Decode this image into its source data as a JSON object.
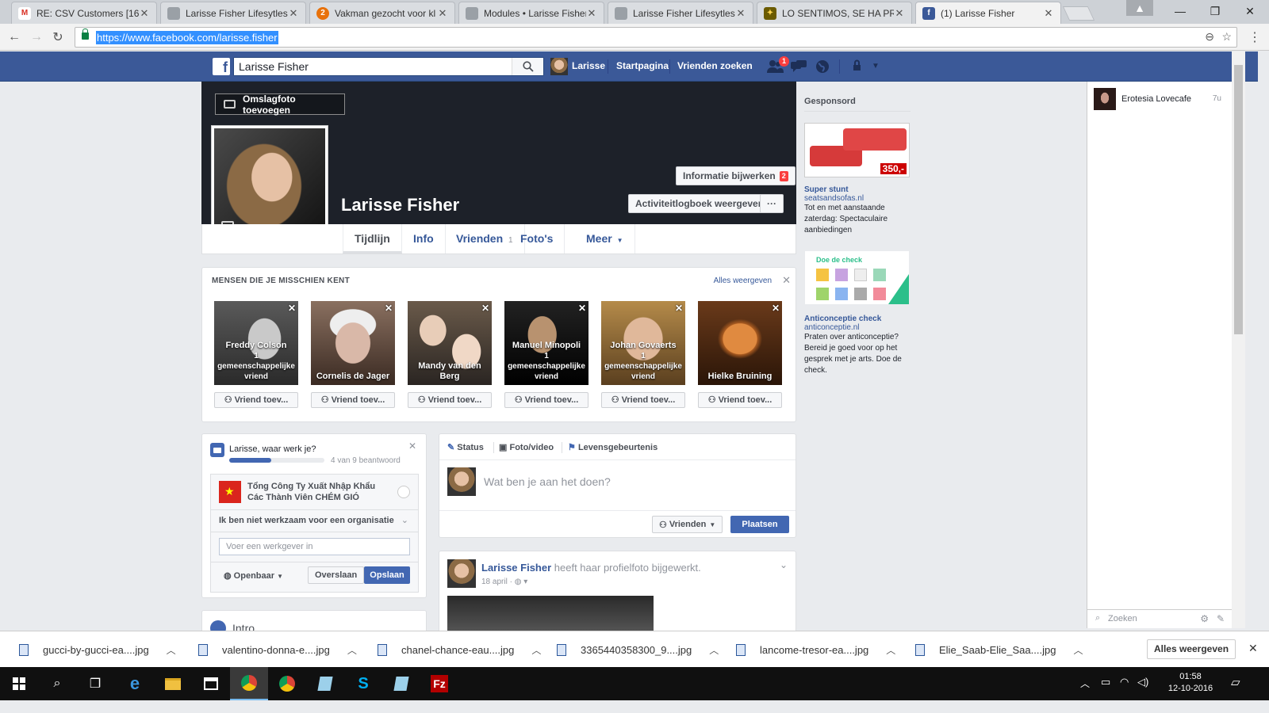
{
  "browser": {
    "tabs": [
      {
        "label": "RE: CSV Customers [1610",
        "icon": "gmail-icon",
        "color": "#d93025",
        "glyph": "M"
      },
      {
        "label": "Larisse Fisher Lifesytlesh",
        "icon": "joomla-icon",
        "color": "#9aa0a6",
        "glyph": ""
      },
      {
        "label": "Vakman gezocht voor kl",
        "icon": "werkspot-icon",
        "color": "#e8710a",
        "glyph": "2"
      },
      {
        "label": "Modules • Larisse Fisher",
        "icon": "joomla-icon",
        "color": "#9aa0a6",
        "glyph": ""
      },
      {
        "label": "Larisse Fisher Lifesytlesh",
        "icon": "joomla-icon",
        "color": "#9aa0a6",
        "glyph": ""
      },
      {
        "label": "LO SENTIMOS, SE HA PR",
        "icon": "site-icon",
        "color": "#6b5b00",
        "glyph": "✦"
      },
      {
        "label": "(1) Larisse Fisher",
        "icon": "facebook-icon",
        "color": "#3b5998",
        "glyph": "f"
      }
    ],
    "url": "https://www.facebook.com/larisse.fisher"
  },
  "fb": {
    "search_value": "Larisse Fisher",
    "nav": {
      "profile_name": "Larisse",
      "home": "Startpagina",
      "find_friends": "Vrienden zoeken",
      "friend_badge": "1"
    },
    "profile": {
      "name": "Larisse Fisher",
      "add_cover": "Omslagfoto toevoegen",
      "update_info": "Informatie bijwerken",
      "update_info_badge": "2",
      "activity_log": "Activiteitlogboek weergeven",
      "more": "···",
      "tabs": {
        "timeline": "Tijdlijn",
        "info": "Info",
        "friends": "Vrienden",
        "friends_count": "1",
        "photos": "Foto's",
        "more": "Meer"
      }
    },
    "pymk": {
      "title": "MENSEN DIE JE MISSCHIEN KENT",
      "see_all": "Alles weergeven",
      "add_label": "Vriend toev...",
      "people": [
        {
          "name": "Freddy Colson",
          "mutual": "1 gemeenschappelijke vriend"
        },
        {
          "name": "Cornelis de Jager",
          "mutual": ""
        },
        {
          "name": "Mandy van den Berg",
          "mutual": ""
        },
        {
          "name": "Manuel Minopoli",
          "mutual": "1 gemeenschappelijke vriend"
        },
        {
          "name": "Johan Govaerts",
          "mutual": "1 gemeenschappelijke vriend"
        },
        {
          "name": "Hielke Bruining",
          "mutual": ""
        }
      ]
    },
    "work": {
      "question": "Larisse, waar werk je?",
      "progress": "4 van 9 beantwoord",
      "progress_fraction": 0.44,
      "company": "Tổng Công Ty Xuất Nhập Khẩu Các Thành Viên CHÉM GIÓ",
      "not_employed": "Ik ben niet werkzaam voor een organisatie",
      "employer_placeholder": "Voer een werkgever in",
      "privacy": "Openbaar",
      "skip": "Overslaan",
      "save": "Opslaan"
    },
    "intro": {
      "title": "Intro"
    },
    "composer": {
      "status": "Status",
      "photo": "Foto/video",
      "life_event": "Levensgebeurtenis",
      "placeholder": "Wat ben je aan het doen?",
      "audience": "Vrienden",
      "post": "Plaatsen"
    },
    "post": {
      "author": "Larisse Fisher",
      "action": "heeft haar profielfoto bijgewerkt.",
      "date": "18 april"
    },
    "sponsored": {
      "title": "Gesponsord",
      "ads": [
        {
          "price": "350,-",
          "title": "Super stunt",
          "domain": "seatsandsofas.nl",
          "text": "Tot en met aanstaande zaterdag: Spectaculaire aanbiedingen"
        },
        {
          "image_text": "Doe de check",
          "title": "Anticonceptie check",
          "domain": "anticonceptie.nl",
          "text": "Praten over anticonceptie? Bereid je goed voor op het gesprek met je arts. Doe de check."
        }
      ]
    },
    "chat": {
      "contact": "Erotesia Lovecafe",
      "time": "7u",
      "search_placeholder": "Zoeken"
    }
  },
  "downloads": {
    "items": [
      "gucci-by-gucci-ea....jpg",
      "valentino-donna-e....jpg",
      "chanel-chance-eau....jpg",
      "3365440358300_9....jpg",
      "lancome-tresor-ea....jpg",
      "Elie_Saab-Elie_Saa....jpg"
    ],
    "show_all": "Alles weergeven"
  },
  "taskbar": {
    "time": "01:58",
    "date": "12-10-2016"
  }
}
